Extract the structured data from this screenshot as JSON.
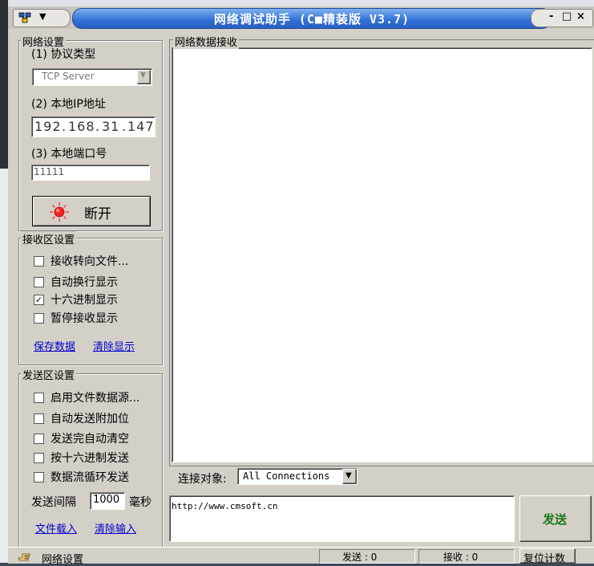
{
  "window": {
    "title": "网络调试助手 (C■精装版 V3.7)",
    "controls": {
      "minimize": "-",
      "maximize": "□",
      "close": "×"
    }
  },
  "network_settings": {
    "group_label": "网络设置",
    "protocol_label": "(1) 协议类型",
    "protocol_value": "TCP Server",
    "ip_label": "(2) 本地IP地址",
    "ip_octets": [
      "192",
      "168",
      "31",
      "147"
    ],
    "port_label": "(3) 本地端口号",
    "port_value": "11111",
    "disconnect_label": "断开"
  },
  "receive_settings": {
    "group_label": "接收区设置",
    "options": [
      {
        "label": "接收转向文件...",
        "checked": false
      },
      {
        "label": "自动换行显示",
        "checked": false
      },
      {
        "label": "十六进制显示",
        "checked": true
      },
      {
        "label": "暂停接收显示",
        "checked": false
      }
    ],
    "save_link": "保存数据",
    "clear_link": "清除显示"
  },
  "send_settings": {
    "group_label": "发送区设置",
    "options": [
      {
        "label": "启用文件数据源...",
        "checked": false
      },
      {
        "label": "自动发送附加位",
        "checked": false
      },
      {
        "label": "发送完自动清空",
        "checked": false
      },
      {
        "label": "按十六进制发送",
        "checked": false
      },
      {
        "label": "数据流循环发送",
        "checked": false
      }
    ],
    "interval_label": "发送间隔",
    "interval_value": "1000",
    "interval_unit": "毫秒",
    "load_file_link": "文件载入",
    "clear_input_link": "清除输入"
  },
  "receive_area": {
    "label": "网络数据接收",
    "content": ""
  },
  "connection": {
    "label": "连接对象:",
    "selected": "All Connections"
  },
  "send_area": {
    "text": "http://www.cmsoft.cn",
    "send_button": "发送"
  },
  "status_bar": {
    "left_text": "网络设置",
    "sent": "发送 : 0",
    "received": "接收 : 0",
    "reset_button": "复位计数"
  },
  "colors": {
    "title_gradient_top": "#7fb1ee",
    "title_gradient_bottom": "#2a5fc0",
    "send_button_text": "#1a7a1a",
    "link": "#0000cc",
    "indicator_red": "#ff2020"
  },
  "icons": [
    "network-app-icon",
    "chevron-down-icon",
    "red-indicator-icon",
    "dropdown-arrow-icon",
    "hand-pointer-icon"
  ]
}
